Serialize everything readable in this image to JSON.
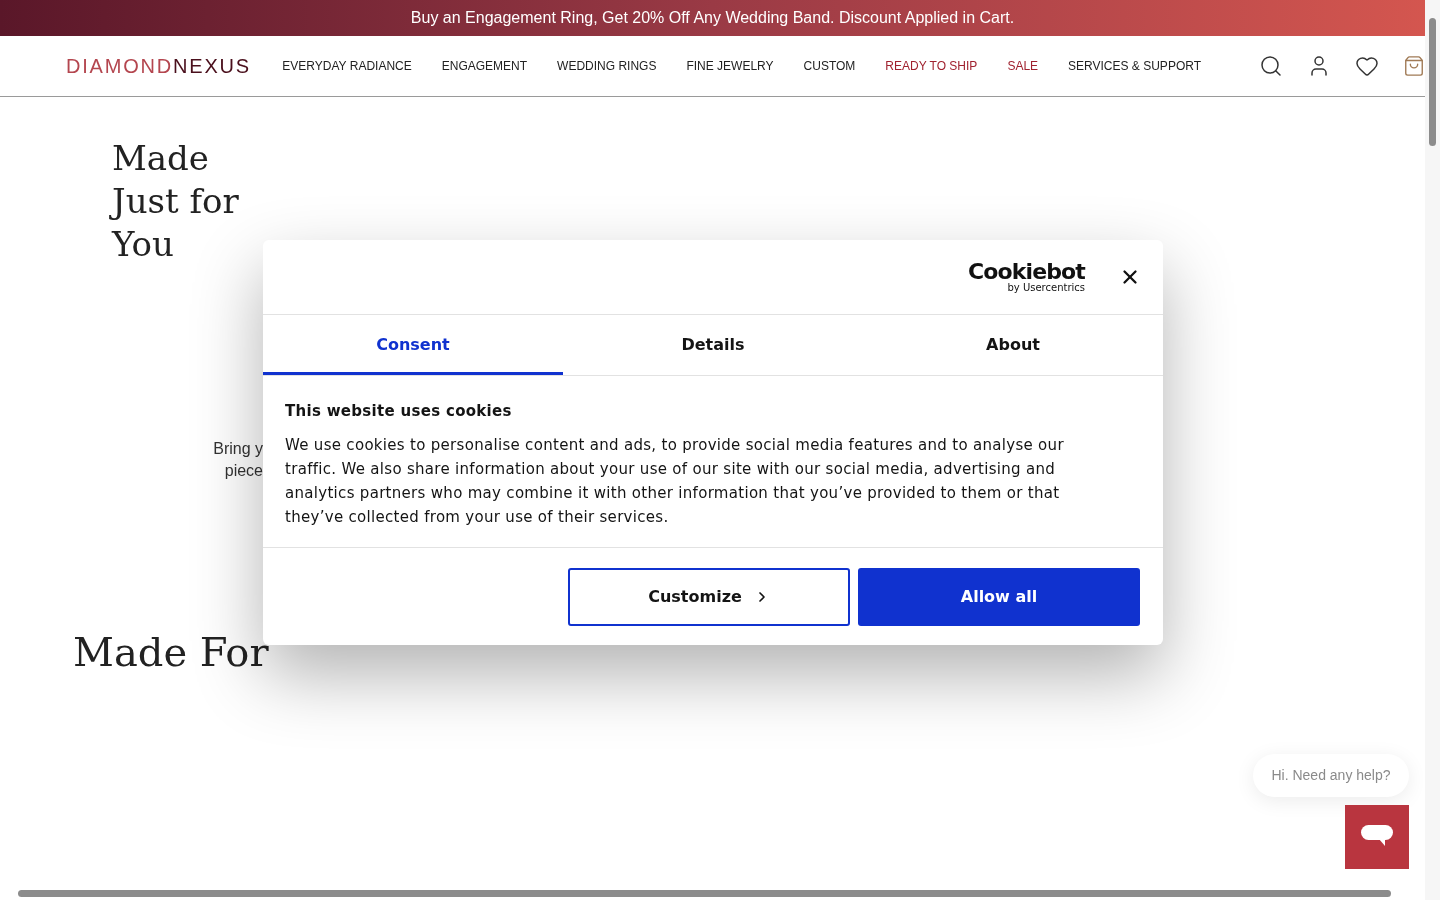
{
  "banner": {
    "text": "Buy an Engagement Ring, Get 20% Off Any Wedding Band. Discount Applied in Cart."
  },
  "header": {
    "logo": {
      "part_1": "DIAMOND",
      "part_2": "NEXUS"
    },
    "nav": [
      {
        "label": "EVERYDAY RADIANCE",
        "highlighted": false
      },
      {
        "label": "ENGAGEMENT",
        "highlighted": false
      },
      {
        "label": "WEDDING RINGS",
        "highlighted": false
      },
      {
        "label": "FINE JEWELRY",
        "highlighted": false
      },
      {
        "label": "CUSTOM",
        "highlighted": false
      },
      {
        "label": "READY TO SHIP",
        "highlighted": true
      },
      {
        "label": "SALE",
        "highlighted": true
      },
      {
        "label": "SERVICES & SUPPORT",
        "highlighted": false
      }
    ]
  },
  "hero": {
    "title_lines": [
      "Made",
      "Just for",
      "You"
    ],
    "subtitle_lines": [
      "Bring y",
      "piece"
    ]
  },
  "section": {
    "title": "Made For"
  },
  "cookie_dialog": {
    "brand": "Cookiebot",
    "brand_sub": "by Usercentrics",
    "tabs": [
      {
        "label": "Consent",
        "selected": true
      },
      {
        "label": "Details",
        "selected": false
      },
      {
        "label": "About",
        "selected": false
      }
    ],
    "heading": "This website uses cookies",
    "body": "We use cookies to personalise content and ads, to provide social media features and to analyse our traffic. We also share information about your use of our site with our social media, advertising and analytics partners who may combine it with other information that you’ve provided to them or that they’ve collected from your use of their services.",
    "buttons": [
      {
        "label": "Customize",
        "kind": "outline"
      },
      {
        "label": "Allow all",
        "kind": "primary"
      }
    ]
  },
  "chat": {
    "greeting": "Hi. Need any help?"
  }
}
